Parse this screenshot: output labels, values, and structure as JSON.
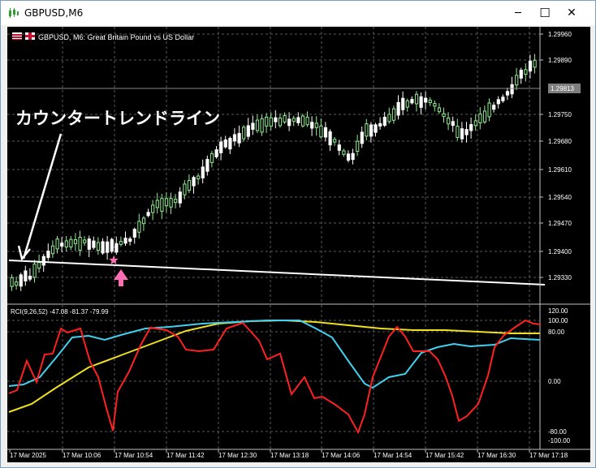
{
  "window": {
    "title": "GBPUSD,M6",
    "controls": {
      "minimize": "─",
      "maximize": "☐",
      "close": "✕"
    }
  },
  "chart": {
    "symbol_label": "GBPUSD, M6:  Great Britain Pound vs US Dollar",
    "annotation_text": "カウンタートレンドライン",
    "current_price": "1.29813",
    "price_ticks": [
      "1.29960",
      "1.29890",
      "1.29750",
      "1.29680",
      "1.29610",
      "1.29540",
      "1.29470",
      "1.29400",
      "1.29330"
    ],
    "time_ticks": [
      "17 Mar 2025",
      "17 Mar 10:06",
      "17 Mar 10:54",
      "17 Mar 11:42",
      "17 Mar 12:30",
      "17 Mar 13:18",
      "17 Mar 14:06",
      "17 Mar 14:54",
      "17 Mar 15:42",
      "17 Mar 16:30",
      "17 Mar 17:18"
    ],
    "colors": {
      "background": "#000000",
      "grid": "#5a5a5a",
      "candle_bull": "#90ee90",
      "candle_bear": "#ffffff",
      "trendline": "#ffffff",
      "marker": "#ff6eb4"
    }
  },
  "indicator": {
    "label": "RCI(9,26,52) -47.08 -81.37 -79.99",
    "ticks": [
      "120.00",
      "100.00",
      "80.00",
      "0.00",
      "-80.00",
      "-100.00"
    ],
    "colors": {
      "rci_short": "#ff2020",
      "rci_mid": "#40d0f0",
      "rci_long": "#f0e020"
    }
  }
}
